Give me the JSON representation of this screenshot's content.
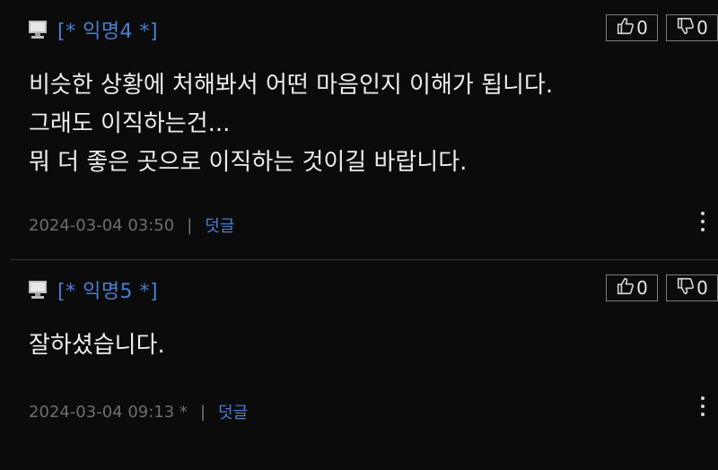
{
  "comments": [
    {
      "author": "[* 익명4 *]",
      "likes": "0",
      "dislikes": "0",
      "lines": [
        "비슷한 상황에 처해봐서 어떤 마음인지 이해가 됩니다.",
        "그래도 이직하는건...",
        "뭐 더 좋은 곳으로 이직하는 것이길 바랍니다."
      ],
      "timestamp": "2024-03-04 03:50",
      "separator": "|",
      "reply_label": "덧글"
    },
    {
      "author": "[* 익명5 *]",
      "likes": "0",
      "dislikes": "0",
      "lines": [
        "잘하셨습니다."
      ],
      "timestamp": "2024-03-04 09:13 *",
      "separator": "|",
      "reply_label": "덧글"
    }
  ],
  "icons": {
    "user": "computer-monitor-icon",
    "like": "thumbs-up-icon",
    "dislike": "thumbs-down-icon",
    "menu": "more-vertical-icon"
  },
  "colors": {
    "background": "#0b0b0b",
    "author": "#4a7fd0",
    "reply_link": "#4a7fd0",
    "timestamp": "#6e6e6e",
    "text": "#ececec"
  }
}
